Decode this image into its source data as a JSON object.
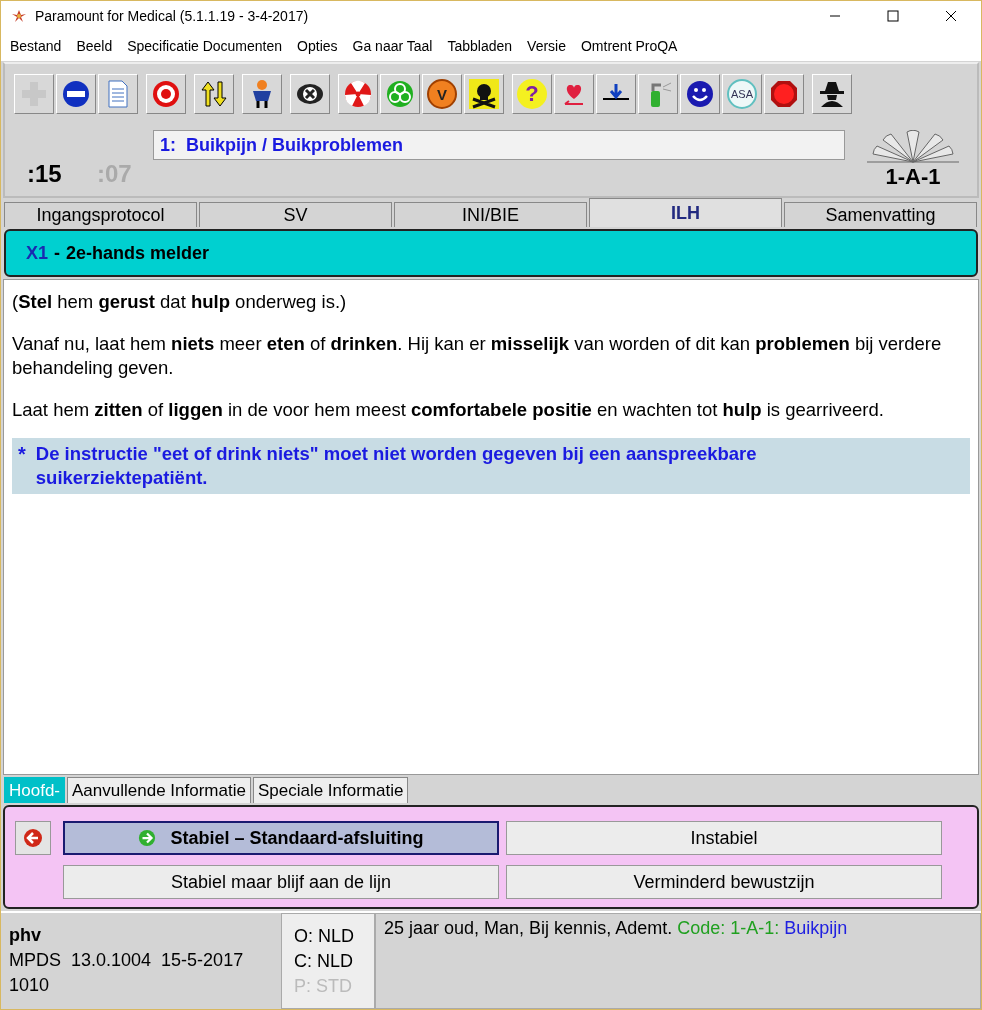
{
  "window": {
    "title": "Paramount for Medical (5.1.1.19 - 3-4-2017)"
  },
  "menu": [
    "Bestand",
    "Beeld",
    "Specificatie Documenten",
    "Opties",
    "Ga naar Taal",
    "Tabbladen",
    "Versie",
    "Omtrent ProQA"
  ],
  "toolbar": [
    [
      {
        "kind": "plus"
      },
      {
        "kind": "minus"
      },
      {
        "kind": "document"
      }
    ],
    [
      {
        "kind": "target"
      }
    ],
    [
      {
        "kind": "arrows"
      }
    ],
    [
      {
        "kind": "figure"
      }
    ],
    [
      {
        "kind": "cross"
      }
    ],
    [
      {
        "kind": "radiation"
      },
      {
        "kind": "biohazard"
      },
      {
        "kind": "badge",
        "label": "V"
      },
      {
        "kind": "skull"
      }
    ],
    [
      {
        "kind": "question",
        "label": "?"
      },
      {
        "kind": "heart"
      },
      {
        "kind": "down"
      },
      {
        "kind": "spray"
      },
      {
        "kind": "smile"
      },
      {
        "kind": "badge-light",
        "label": "ASA"
      },
      {
        "kind": "stop"
      }
    ],
    [
      {
        "kind": "spy"
      }
    ]
  ],
  "timers": {
    "elapsed": ":15",
    "secondary": ":07"
  },
  "protocol": {
    "number": "1:",
    "name": "Buikpijn / Buikproblemen"
  },
  "determinant": "1-A-1",
  "tabs": [
    {
      "label": "Ingangsprotocol",
      "selected": false
    },
    {
      "label": "SV",
      "selected": false
    },
    {
      "label": "INI/BIE",
      "selected": false
    },
    {
      "label": "ILH",
      "selected": true
    },
    {
      "label": "Samenvatting",
      "selected": false
    }
  ],
  "section": {
    "code": "X1",
    "dash": "-",
    "title": "2e-hands melder"
  },
  "paragraphs": [
    "(**Stel** hem **gerust** dat **hulp** onderweg is.)",
    "Vanaf nu, laat hem **niets** meer **eten** of **drinken**.  Hij kan er **misselijk** van worden of dit kan **problemen** bij verdere behandeling geven.",
    "Laat hem **zitten** of **liggen** in de voor hem meest **comfortabele positie** en wachten tot **hulp** is gearriveerd."
  ],
  "note": {
    "mark": "*",
    "text": "De instructie \"eet of drink niets\" moet niet worden gegeven bij een aanspreekbare suikerziektepatiënt."
  },
  "subtabs": [
    {
      "label": "Hoofd-",
      "selected": true
    },
    {
      "label": "Aanvullende Informatie",
      "selected": false
    },
    {
      "label": "Speciale Informatie",
      "selected": false
    }
  ],
  "actions": [
    {
      "label": "Stabiel – Standaard-afsluiting",
      "selected": true
    },
    {
      "label": "Instabiel",
      "selected": false
    },
    {
      "label": "Stabiel maar blijf aan de lijn",
      "selected": false
    },
    {
      "label": "Verminderd bewustzijn",
      "selected": false
    }
  ],
  "status": {
    "user": "phv",
    "version": "MPDS  13.0.1004  15-5-2017",
    "id": "1010",
    "languages": [
      {
        "label": "O: NLD",
        "disabled": false
      },
      {
        "label": "C: NLD",
        "disabled": false
      },
      {
        "label": "P: STD",
        "disabled": true
      }
    ],
    "summary": "25 jaar oud, Man, Bij kennis, Ademt.",
    "code_label": "Code: 1-A-1:",
    "code_name": "Buikpijn"
  }
}
